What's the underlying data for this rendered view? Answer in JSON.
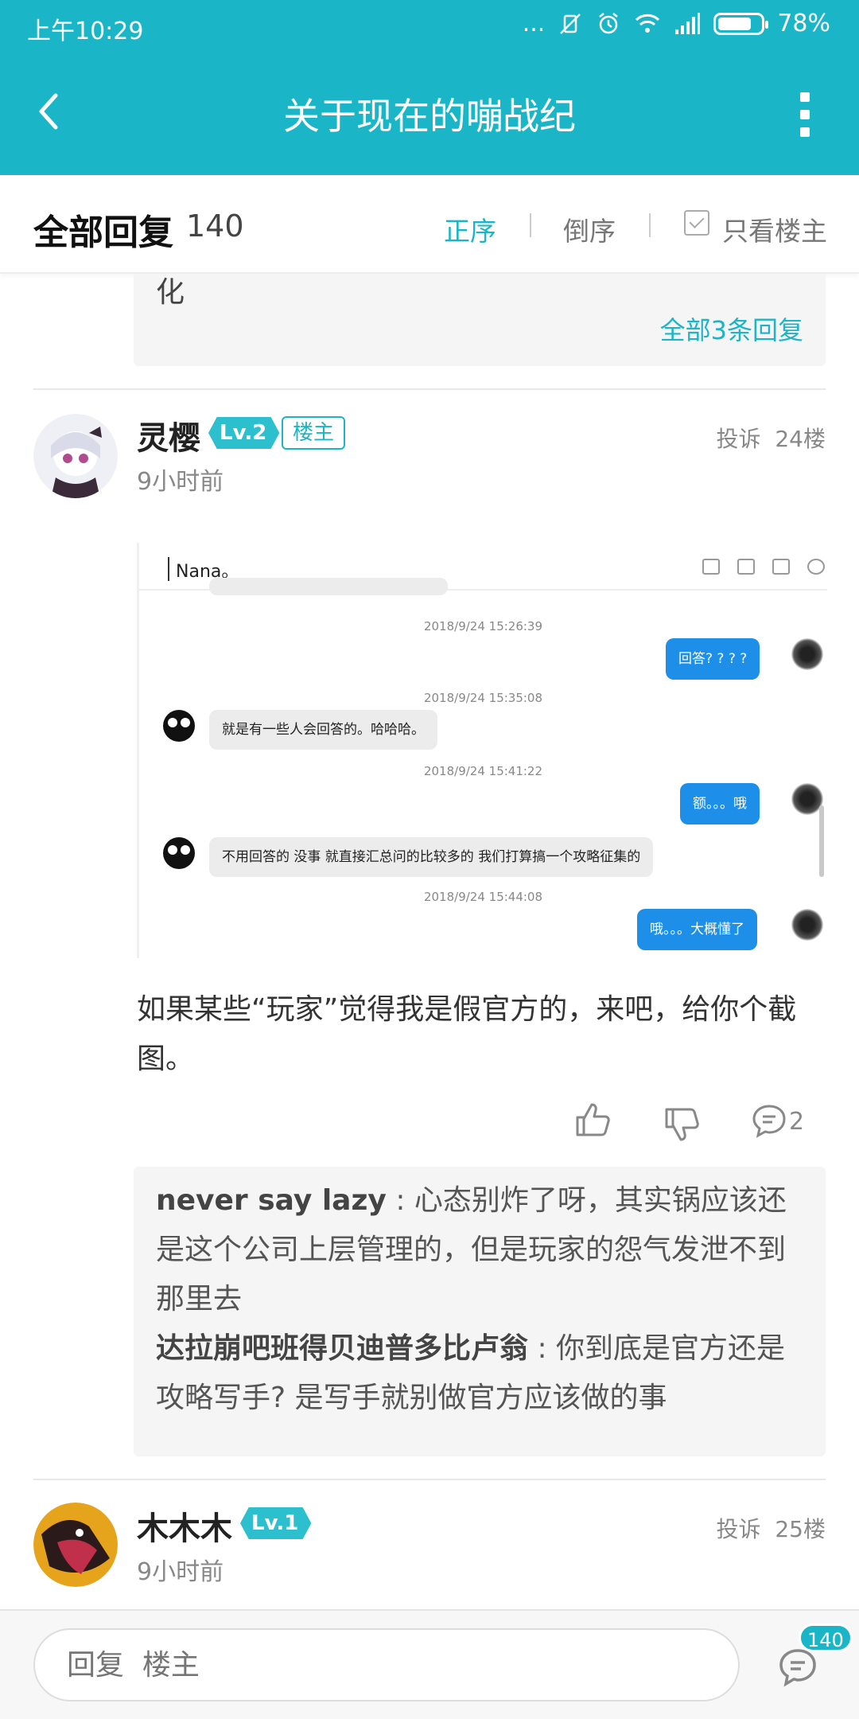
{
  "status_bar": {
    "time": "上午10:29",
    "dots": "...",
    "battery": "78%",
    "battery_level": 0.78
  },
  "header": {
    "title": "关于现在的嘣战纪"
  },
  "sort_bar": {
    "label": "全部回复",
    "count": "140",
    "ascending": "正序",
    "descending": "倒序",
    "only_owner": "只看楼主"
  },
  "prev_reply_block": {
    "cut_text": "化",
    "all_replies": "全部3条回复"
  },
  "posts": [
    {
      "username": "灵樱",
      "level": "Lv.2",
      "owner_tag": "楼主",
      "report": "投诉",
      "floor": "24楼",
      "time_ago": "9小时前",
      "screenshot": {
        "chat_name": "Nana。",
        "messages": [
          {
            "timestamp": "2018/9/24 15:26:39"
          },
          {
            "side": "right",
            "text": "回答? ? ? ?"
          },
          {
            "timestamp": "2018/9/24 15:35:08"
          },
          {
            "side": "left",
            "text": "就是有一些人会回答的。哈哈哈。"
          },
          {
            "timestamp": "2018/9/24 15:41:22"
          },
          {
            "side": "right",
            "text": "额。。。哦"
          },
          {
            "side": "left",
            "text": "不用回答的 没事 就直接汇总问的比较多的 我们打算搞一个攻略征集的"
          },
          {
            "timestamp": "2018/9/24 15:44:08"
          },
          {
            "side": "right",
            "text": "哦。。。大概懂了"
          }
        ]
      },
      "text": "如果某些“玩家”觉得我是假官方的，来吧，给你个截图。",
      "reply_count": "2",
      "sub_replies": [
        {
          "author": "never say lazy",
          "sep": " : ",
          "text": "心态别炸了呀，其实锅应该还是这个公司上层管理的，但是玩家的怨气发泄不到那里去"
        },
        {
          "author": "达拉崩吧班得贝迪普多比卢翁",
          "sep": " : ",
          "text": "你到底是官方还是攻略写手? 是写手就别做官方应该做的事"
        }
      ]
    },
    {
      "username": "木木木",
      "level": "Lv.1",
      "report": "投诉",
      "floor": "25楼",
      "time_ago": "9小时前"
    }
  ],
  "bottom": {
    "reply_placeholder": "回复  楼主",
    "badge": "140"
  },
  "colors": {
    "accent": "#1ab5c6",
    "bubble_blue": "#1e8fe8"
  }
}
